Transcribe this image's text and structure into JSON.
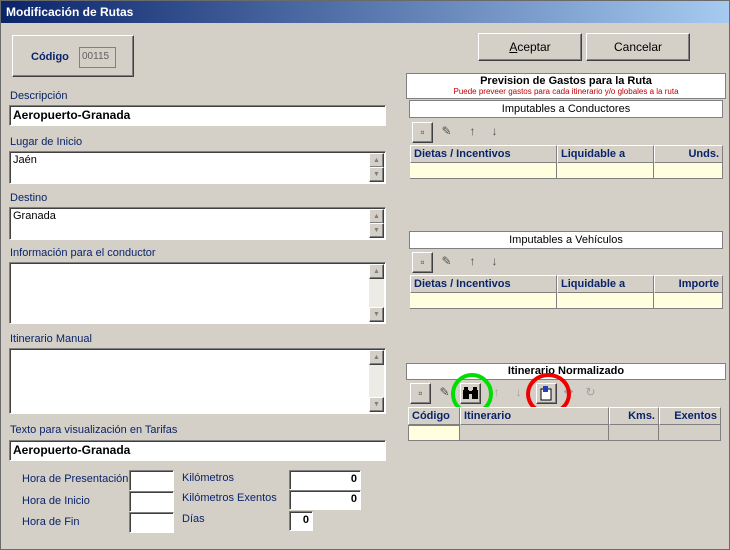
{
  "window": {
    "title": "Modificación de Rutas"
  },
  "codigo": {
    "label": "Código",
    "value": "00115"
  },
  "buttons": {
    "accept": "Aceptar",
    "accept_key": "A",
    "accept_rest": "ceptar",
    "cancel": "Cancelar"
  },
  "descripcion": {
    "label": "Descripción",
    "value": "Aeropuerto-Granada"
  },
  "lugar_inicio": {
    "label": "Lugar de Inicio",
    "value": "Jaén"
  },
  "destino": {
    "label": "Destino",
    "value": "Granada"
  },
  "info_conductor": {
    "label": "Información para el conductor",
    "value": ""
  },
  "itinerario_manual": {
    "label": "Itinerario Manual",
    "value": ""
  },
  "texto_tarifas": {
    "label": "Texto para visualización en Tarifas",
    "value": "Aeropuerto-Granada"
  },
  "horas": {
    "presentacion": {
      "label": "Hora de Presentación",
      "value": ""
    },
    "inicio": {
      "label": "Hora de Inicio",
      "value": ""
    },
    "fin": {
      "label": "Hora de Fin",
      "value": ""
    }
  },
  "kilometros": {
    "km": {
      "label": "Kilómetros",
      "value": "0"
    },
    "km_exentos": {
      "label": "Kilómetros Exentos",
      "value": "0"
    },
    "dias": {
      "label": "Días",
      "value": "0"
    }
  },
  "prevision": {
    "title": "Prevision de Gastos para la Ruta",
    "subtitle": "Puede preveer gastos para cada itinerario y/o globales a la ruta",
    "conductores": {
      "title": "Imputables a Conductores",
      "columns": [
        "Dietas / Incentivos",
        "Liquidable a",
        "Unds."
      ]
    },
    "vehiculos": {
      "title": "Imputables a Vehículos",
      "columns": [
        "Dietas / Incentivos",
        "Liquidable a",
        "Importe"
      ]
    }
  },
  "itinerario_normalizado": {
    "title": "Itinerario Normalizado",
    "columns": [
      "Código",
      "Itinerario",
      "Kms.",
      "Exentos"
    ]
  },
  "colors": {
    "title_start": "#0a246a",
    "title_end": "#a6caf0",
    "label": "#0a246a",
    "grid_row": "#ffffe0",
    "highlight_green": "#00dd00",
    "highlight_red": "#ee0000"
  }
}
